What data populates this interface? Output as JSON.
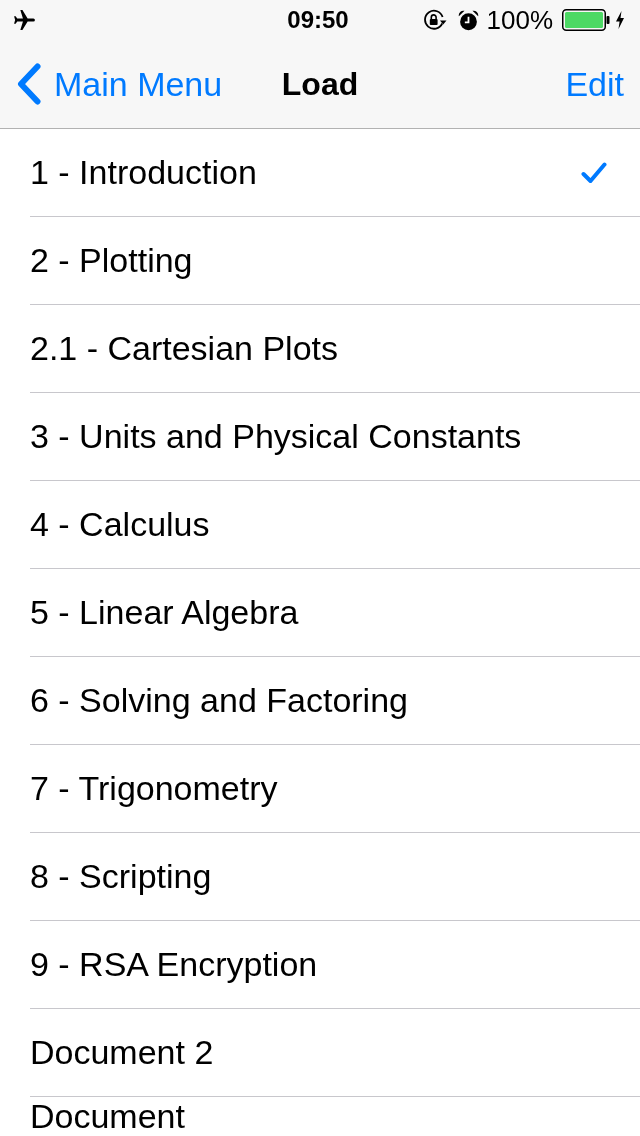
{
  "status_bar": {
    "time": "09:50",
    "battery": "100%"
  },
  "nav_bar": {
    "back": "Main Menu",
    "title": "Load",
    "action": "Edit"
  },
  "documents": [
    {
      "name": "1 - Introduction",
      "selected": true
    },
    {
      "name": "2 - Plotting",
      "selected": false
    },
    {
      "name": "2.1 - Cartesian Plots",
      "selected": false
    },
    {
      "name": "3 - Units and Physical Constants",
      "selected": false
    },
    {
      "name": "4 - Calculus",
      "selected": false
    },
    {
      "name": "5 - Linear Algebra",
      "selected": false
    },
    {
      "name": "6 - Solving and Factoring",
      "selected": false
    },
    {
      "name": "7 - Trigonometry",
      "selected": false
    },
    {
      "name": "8 - Scripting",
      "selected": false
    },
    {
      "name": "9 - RSA Encryption",
      "selected": false
    },
    {
      "name": "Document 2",
      "selected": false
    },
    {
      "name": "Document",
      "selected": false
    }
  ]
}
